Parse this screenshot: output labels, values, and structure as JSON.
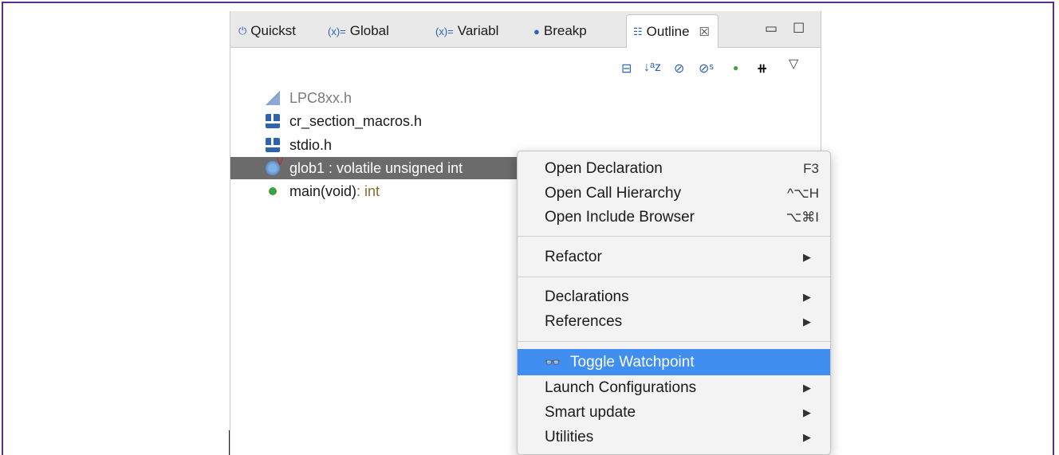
{
  "tabs": [
    {
      "icon": "quickstart-icon",
      "glyph": "⏻",
      "label": "Quickst"
    },
    {
      "icon": "global-variables-icon",
      "glyph": "(x)=",
      "label": "Global"
    },
    {
      "icon": "variables-icon",
      "glyph": "(x)=",
      "label": "Variabl"
    },
    {
      "icon": "breakpoints-icon",
      "glyph": "●",
      "label": "Breakp"
    },
    {
      "icon": "outline-icon",
      "glyph": "☷",
      "label": "Outline",
      "close": "☒"
    }
  ],
  "window_buttons": {
    "minimize": "▭",
    "maximize": "☐"
  },
  "toolbar": {
    "collapse": "⊟",
    "sort": "↓ᵃz",
    "hide_fields": "⊘",
    "hide_static": "⊘ˢ",
    "hide_nonpublic": "●",
    "group": "⧺",
    "menu": "▽"
  },
  "tree": [
    {
      "label": "LPC8xx.h",
      "type": "",
      "icon": "lpc-header-icon",
      "dim": true
    },
    {
      "label": "cr_section_macros.h",
      "type": "",
      "icon": "header-file-icon"
    },
    {
      "label": "stdio.h",
      "type": "",
      "icon": "header-file-icon"
    },
    {
      "label": "glob1 : volatile unsigned int",
      "type": "",
      "icon": "variable-icon",
      "selected": true,
      "marker": "V"
    },
    {
      "label": "main(void)",
      "type": " : int",
      "icon": "function-icon"
    }
  ],
  "context_menu": {
    "items": [
      {
        "label": "Open Declaration",
        "shortcut": "F3"
      },
      {
        "label": "Open Call Hierarchy",
        "shortcut": "^⌥H"
      },
      {
        "label": "Open Include Browser",
        "shortcut": "⌥⌘I"
      },
      {
        "label": "Refactor",
        "submenu": "▶"
      },
      {
        "label": "Declarations",
        "submenu": "▶"
      },
      {
        "label": "References",
        "submenu": "▶"
      },
      {
        "label": "Toggle Watchpoint",
        "icon": "👓",
        "highlighted": true
      },
      {
        "label": "Launch Configurations",
        "submenu": "▶"
      },
      {
        "label": "Smart update",
        "submenu": "▶"
      },
      {
        "label": "Utilities",
        "submenu": "▶"
      }
    ]
  },
  "colors": {
    "highlight": "#3f8ef0",
    "selection": "#6b6b6b",
    "frame": "#5b2d8c"
  }
}
